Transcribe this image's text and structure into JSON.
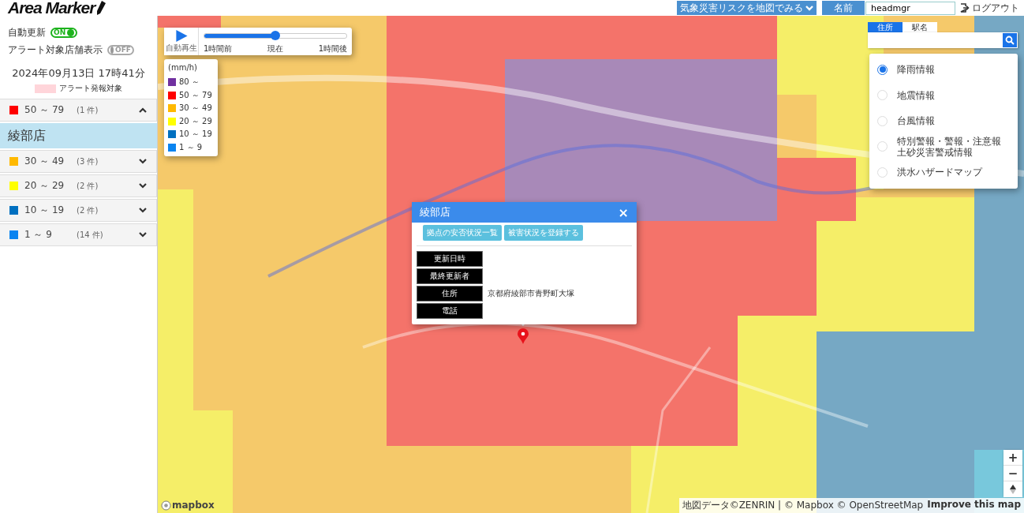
{
  "header": {
    "logo": "Area Marker",
    "risk_menu": "気象災害リスクを地図でみる",
    "name_label": "名前",
    "name_value": "headmgr",
    "logout": "ログアウト"
  },
  "sidebar": {
    "toggles": [
      {
        "label": "自動更新",
        "state_text": "ON",
        "on": true
      },
      {
        "label": "アラート対象店舗表示",
        "state_text": "OFF",
        "on": false
      }
    ],
    "datetime": "2024年09月13日 17時41分",
    "alert_legend": "アラート発報対象",
    "groups": [
      {
        "range": "50 ～ 79",
        "count": "(1 件)",
        "color": "#ff0000",
        "expanded": true,
        "stores": [
          {
            "name": "綾部店",
            "selected": true
          }
        ]
      },
      {
        "range": "30 ～ 49",
        "count": "(3 件)",
        "color": "#ffb900",
        "expanded": false
      },
      {
        "range": "20 ～ 29",
        "count": "(2 件)",
        "color": "#ffff00",
        "expanded": false
      },
      {
        "range": "10 ～ 19",
        "count": "(2 件)",
        "color": "#0070c0",
        "expanded": false
      },
      {
        "range": "1 ～ 9",
        "count": "(14 件)",
        "color": "#0a84f0",
        "expanded": false
      }
    ]
  },
  "playback": {
    "play_label": "自動再生",
    "level": 0.5,
    "labels": [
      "1時間前",
      "現在",
      "1時間後"
    ]
  },
  "legend": {
    "unit": "(mm/h)",
    "items": [
      {
        "label": "80 ～",
        "color": "#7030a0"
      },
      {
        "label": "50 ～ 79",
        "color": "#ff0000"
      },
      {
        "label": "30 ～ 49",
        "color": "#ffb900"
      },
      {
        "label": "20 ～ 29",
        "color": "#ffff00"
      },
      {
        "label": "10 ～ 19",
        "color": "#0070c0"
      },
      {
        "label": "1 ～ 9",
        "color": "#0a84f0"
      }
    ]
  },
  "search": {
    "tabs": [
      {
        "label": "住所",
        "selected": true
      },
      {
        "label": "駅名",
        "selected": false
      }
    ]
  },
  "layers": [
    {
      "label": "降雨情報",
      "selected": true
    },
    {
      "label": "地震情報",
      "selected": false
    },
    {
      "label": "台風情報",
      "selected": false
    },
    {
      "lines": [
        "特別警報・警報・注意報",
        "土砂災害警戒情報"
      ],
      "selected": false
    },
    {
      "label": "洪水ハザードマップ",
      "selected": false
    }
  ],
  "popup": {
    "title": "綾部店",
    "close": "×",
    "buttons": [
      "拠点の安否状況一覧",
      "被害状況を登録する"
    ],
    "fields": [
      {
        "label": "更新日時"
      },
      {
        "label": "最終更新者"
      },
      {
        "label": "住所",
        "value": "京都府綾部市青野町大塚"
      },
      {
        "label": "電話"
      }
    ]
  },
  "map_controls": {
    "zoom_in": "+",
    "zoom_out": "−"
  },
  "attribution": {
    "text": "地図データ©ZENRIN | © Mapbox © OpenStreetMap",
    "link": "Improve this map",
    "logo": "mapbox"
  }
}
